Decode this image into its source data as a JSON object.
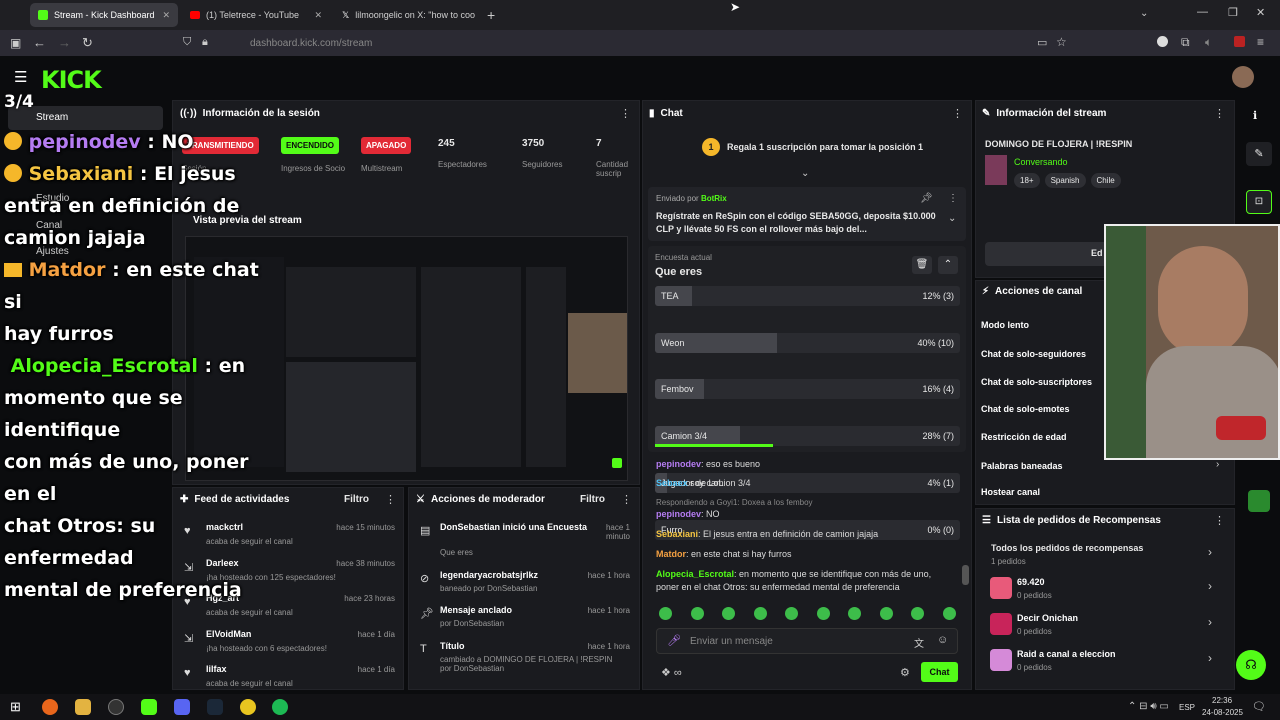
{
  "tabs": [
    {
      "label": "Stream - Kick Dashboard"
    },
    {
      "label": "(1) Teletrece - YouTube"
    },
    {
      "label": "lilmoongelic on X: \"how to coo"
    }
  ],
  "url": "dashboard.kick.com/stream",
  "logo": "KICK",
  "nav": {
    "counter": "3/4",
    "stream": "Stream",
    "estudio": "Estudio",
    "canal": "Canal",
    "ajustes": "Ajustes"
  },
  "session": {
    "title": "Información de la sesión",
    "status1": "TRANSMITIENDO",
    "status1_sub": "Sesión",
    "status2": "ENCENDIDO",
    "status2_sub": "Ingresos de Socio",
    "status3": "APAGADO",
    "status3_sub": "Multistream",
    "viewers": "245",
    "viewers_label": "Espectadores",
    "followers": "3750",
    "followers_label": "Seguidores",
    "subs": "7",
    "subs_label": "Cantidad suscrip"
  },
  "preview": {
    "title": "Vista previa del stream"
  },
  "chat": {
    "title": "Chat",
    "gift_pos": "1",
    "gift_text": "Regala 1 suscripción para tomar la posición 1",
    "pinned_by": "Enviado por",
    "pinned_user": "BotRix",
    "pinned_msg": "Regístrate en ReSpin con el código SEBA50GG, deposita $10.000 CLP y llévate 50 FS con el rollover más bajo del...",
    "poll_label": "Encuesta actual",
    "poll_q": "Que eres",
    "poll": [
      {
        "name": "TEA",
        "result": "12% (3)",
        "pct": 12
      },
      {
        "name": "Weon",
        "result": "40% (10)",
        "pct": 40
      },
      {
        "name": "Fembov",
        "result": "16% (4)",
        "pct": 16
      },
      {
        "name": "Camion 3/4",
        "result": "28% (7)",
        "pct": 28
      },
      {
        "name": "Jugador de LoL",
        "result": "4% (1)",
        "pct": 4
      },
      {
        "name": "Furro",
        "result": "0% (0)",
        "pct": 0
      }
    ],
    "messages": [
      {
        "user": "pepinodev",
        "color": "#b57cf2",
        "text": ": eso es bueno"
      },
      {
        "user": "Sebaex",
        "color": "#4fc3f7",
        "text": " soy camion 3/4"
      },
      {
        "user": "Respondiendo a Goyi1: Doxea a los femboy",
        "color": "#888",
        "text": ""
      },
      {
        "user": "pepinodev",
        "color": "#b57cf2",
        "text": ": NO"
      },
      {
        "user": "Sebaxiani",
        "color": "#f5c542",
        "text": ": El jesus entra en definición de camion jajaja"
      },
      {
        "user": "Matdor",
        "color": "#f5a142",
        "text": ": en este chat si hay furros"
      },
      {
        "user": "Alopecia_Escrotal",
        "color": "#53fc18",
        "text": ": en momento que se identifique con más de uno,"
      },
      {
        "user": "",
        "color": "#ddd",
        "text": "poner en el chat Otros: su enfermedad mental de preferencia"
      }
    ],
    "input_placeholder": "Enviar un mensaje",
    "send": "Chat"
  },
  "info": {
    "title": "Información del stream",
    "stream_title": "DOMINGO DE FLOJERA | !RESPIN",
    "category": "Conversando",
    "tags": [
      "18+",
      "Spanish",
      "Chile"
    ],
    "edit": "Ed"
  },
  "actions": {
    "title": "Acciones de canal",
    "items": [
      "Modo lento",
      "Chat de solo-seguidores",
      "Chat de solo-suscriptores",
      "Chat de solo-emotes",
      "Restricción de edad",
      "Palabras baneadas",
      "Hostear canal"
    ]
  },
  "rewards": {
    "title": "Lista de pedidos de Recompensas",
    "all": "Todos los pedidos de recompensas",
    "all_sub": "1 pedidos",
    "items": [
      {
        "name": "69.420",
        "sub": "0 pedidos"
      },
      {
        "name": "Decir Onichan",
        "sub": "0 pedidos"
      },
      {
        "name": "Raid a canal a eleccion",
        "sub": "0 pedidos"
      }
    ]
  },
  "feed": {
    "title": "Feed de actividades",
    "filter": "Filtro",
    "items": [
      {
        "user": "mackctrl",
        "time": "hace 15 minutos",
        "desc": "acaba de seguir el canal"
      },
      {
        "user": "Darleex",
        "time": "hace 38 minutos",
        "desc": "¡ha hosteado con 125 espectadores!"
      },
      {
        "user": "Hgz_art",
        "time": "hace 23 horas",
        "desc": "acaba de seguir el canal"
      },
      {
        "user": "ElVoidMan",
        "time": "hace 1 día",
        "desc": "¡ha hosteado con 6 espectadores!"
      },
      {
        "user": "lilfax",
        "time": "hace 1 día",
        "desc": "acaba de seguir el canal"
      }
    ]
  },
  "mod": {
    "title": "Acciones de moderador",
    "filter": "Filtro",
    "items": [
      {
        "title": "DonSebastian inició una Encuesta",
        "time": "hace 1 minuto",
        "desc": "Que eres"
      },
      {
        "title": "legendaryacrobatsjrlkz",
        "time": "hace 1 hora",
        "desc": "baneado por DonSebastian"
      },
      {
        "title": "Mensaje anclado",
        "time": "hace 1 hora",
        "desc": "por DonSebastian"
      },
      {
        "title": "Título",
        "time": "hace 1 hora",
        "desc": "cambiado a DOMINGO DE FLOJERA | !RESPIN por DonSebastian"
      }
    ]
  },
  "overlay": {
    "l1u": "pepinodev",
    "l1t": " : NO",
    "l2u": "Sebaxiani",
    "l2t": " : El jesus",
    "l3": "entra en definición de",
    "l4": "camion jajaja",
    "l5u": "Matdor",
    "l5t": " : en este chat si",
    "l6": "hay furros",
    "l7u": "Alopecia_Escrotal",
    "l7t": " : en",
    "l8": "momento que se identifique",
    "l9": "con más de uno, poner en el",
    "l10": "chat Otros: su enfermedad",
    "l11": "mental de preferencia"
  },
  "taskbar": {
    "lang": "ESP",
    "time": "22:36",
    "date": "24-08-2025"
  }
}
